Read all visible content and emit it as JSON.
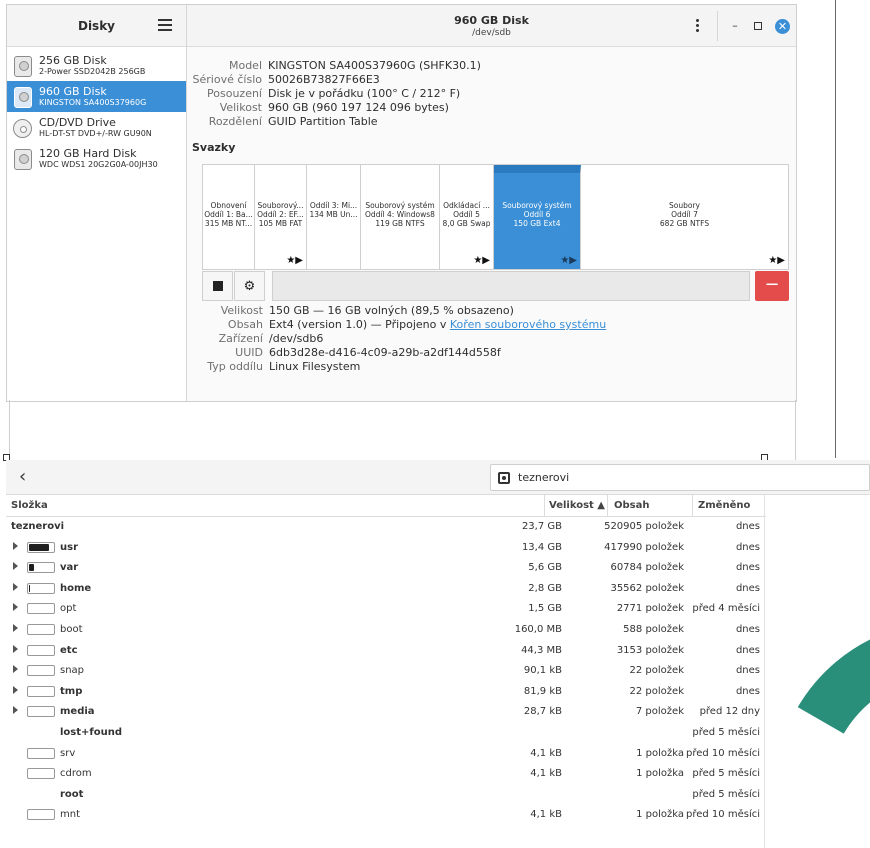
{
  "disks_window": {
    "sidebar_title": "Disky",
    "disks": [
      {
        "name": "256 GB Disk",
        "model": "2-Power SSD2042B 256GB",
        "icon": "hdd-icon",
        "selected": false
      },
      {
        "name": "960 GB Disk",
        "model": "KINGSTON SA400S37960G",
        "icon": "hdd-icon",
        "selected": true
      },
      {
        "name": "CD/DVD Drive",
        "model": "HL-DT-ST DVD+/-RW GU90N",
        "icon": "optical-disc-icon",
        "selected": false
      },
      {
        "name": "120 GB Hard Disk",
        "model": "WDC WDS1 20G2G0A-00JH30",
        "icon": "hdd-icon",
        "selected": false
      }
    ],
    "title": "960 GB Disk",
    "subtitle": "/dev/sdb",
    "close_glyph": "✕",
    "min_glyph": "–",
    "info": {
      "model_label": "Model",
      "model": "KINGSTON SA400S37960G (SHFK30.1)",
      "serial_label": "Sériové číslo",
      "serial": "50026B73827F66E3",
      "assessment_label": "Posouzení",
      "assessment": "Disk je v pořádku (100° C / 212° F)",
      "size_label": "Velikost",
      "size": "960 GB (960 197 124 096 bytes)",
      "partitioning_label": "Rozdělení",
      "partitioning": "GUID Partition Table"
    },
    "volumes_title": "Svazky",
    "partitions": [
      {
        "line1": "Obnovení",
        "line2": "Oddíl 1: Ba...",
        "line3": "315 MB NT...",
        "star": ""
      },
      {
        "line1": "Souborový...",
        "line2": "Oddíl 2: EF...",
        "line3": "105 MB FAT",
        "star": "★▶"
      },
      {
        "line1": "Oddíl 3: Mi...",
        "line2": "134 MB Un...",
        "line3": "",
        "star": ""
      },
      {
        "line1": "Souborový systém",
        "line2": "Oddíl 4: Windows8",
        "line3": "119 GB NTFS",
        "star": ""
      },
      {
        "line1": "Odkládací ...",
        "line2": "Oddíl 5",
        "line3": "8,0 GB Swap",
        "star": "★▶"
      },
      {
        "line1": "Souborový systém",
        "line2": "Oddíl 6",
        "line3": "150 GB Ext4",
        "star": "★▶"
      },
      {
        "line1": "Soubory",
        "line2": "Oddíl 7",
        "line3": "682 GB NTFS",
        "star": "★▶"
      }
    ],
    "gear_glyph": "⚙",
    "delete_glyph": "−",
    "selected_volume": {
      "size_label": "Velikost",
      "size": "150 GB — 16 GB volných (89,5 % obsazeno)",
      "contents_label": "Obsah",
      "contents_prefix": "Ext4 (version 1.0) — Připojeno v ",
      "contents_link": "Kořen souborového systému",
      "device_label": "Zařízení",
      "device": "/dev/sdb6",
      "uuid_label": "UUID",
      "uuid": "6db3d28e-d416-4c09-a29b-a2df144d558f",
      "type_label": "Typ oddílu",
      "type": "Linux Filesystem"
    }
  },
  "file_window": {
    "back_glyph": "‹",
    "location": "teznerovi",
    "columns": {
      "folder": "Složka",
      "size": "Velikost ▲",
      "contents": "Obsah",
      "modified": "Změněno"
    },
    "root": {
      "name": "teznerovi",
      "size": "23,7 GB",
      "contents": "520905 položek",
      "modified": "dnes"
    },
    "rows": [
      {
        "name": "usr",
        "bold": true,
        "expand": true,
        "fill": 0.82,
        "size": "13,4 GB",
        "contents": "417990 položek",
        "modified": "dnes"
      },
      {
        "name": "var",
        "bold": true,
        "expand": true,
        "fill": 0.2,
        "size": "5,6 GB",
        "contents": "60784 položek",
        "modified": "dnes"
      },
      {
        "name": "home",
        "bold": true,
        "expand": true,
        "fill": 0.05,
        "size": "2,8 GB",
        "contents": "35562 položek",
        "modified": "dnes"
      },
      {
        "name": "opt",
        "bold": false,
        "expand": true,
        "fill": 0,
        "size": "1,5 GB",
        "contents": "2771 položek",
        "modified": "před 4 měsíci"
      },
      {
        "name": "boot",
        "bold": false,
        "expand": true,
        "fill": 0,
        "size": "160,0 MB",
        "contents": "588 položek",
        "modified": "dnes"
      },
      {
        "name": "etc",
        "bold": true,
        "expand": true,
        "fill": 0,
        "size": "44,3 MB",
        "contents": "3153 položek",
        "modified": "dnes"
      },
      {
        "name": "snap",
        "bold": false,
        "expand": true,
        "fill": 0,
        "size": "90,1 kB",
        "contents": "22 položek",
        "modified": "dnes"
      },
      {
        "name": "tmp",
        "bold": true,
        "expand": true,
        "fill": 0,
        "size": "81,9 kB",
        "contents": "22 položek",
        "modified": "dnes"
      },
      {
        "name": "media",
        "bold": true,
        "expand": true,
        "fill": 0,
        "size": "28,7 kB",
        "contents": "7 položek",
        "modified": "před 12 dny"
      },
      {
        "name": "lost+found",
        "bold": true,
        "expand": false,
        "fill": null,
        "size": "",
        "contents": "",
        "modified": "před 5 měsíci"
      },
      {
        "name": "srv",
        "bold": false,
        "expand": false,
        "fill": 0,
        "size": "4,1 kB",
        "contents": "1 položka",
        "modified": "před 10 měsíci"
      },
      {
        "name": "cdrom",
        "bold": false,
        "expand": false,
        "fill": 0,
        "size": "4,1 kB",
        "contents": "1 položka",
        "modified": "před 5 měsíci"
      },
      {
        "name": "root",
        "bold": true,
        "expand": false,
        "fill": null,
        "size": "",
        "contents": "",
        "modified": "před 5 měsíci"
      },
      {
        "name": "mnt",
        "bold": false,
        "expand": false,
        "fill": 0,
        "size": "4,1 kB",
        "contents": "1 položka",
        "modified": "před 10 měsíci"
      }
    ]
  },
  "colors": {
    "accent": "#3a8fd6",
    "danger": "#e44b4b",
    "ring": "#2a8f7a"
  }
}
